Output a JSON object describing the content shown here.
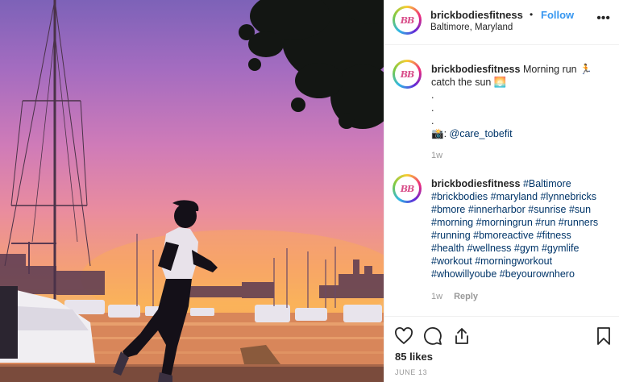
{
  "post": {
    "username": "brickbodiesfitness",
    "separator": "•",
    "follow_label": "Follow",
    "location": "Baltimore, Maryland",
    "more_label": "•••",
    "avatar_text": "BB"
  },
  "caption": {
    "username": "brickbodiesfitness",
    "text_line1": "Morning run 🏃",
    "text_line2": "catch the sun 🌅",
    "dots": ".",
    "credit_icon": "📸",
    "credit_handle": "@care_tobefit",
    "age": "1w"
  },
  "hashtag_comment": {
    "username": "brickbodiesfitness",
    "tags": [
      "#Baltimore",
      "#brickbodies",
      "#maryland",
      "#lynnebricks",
      "#bmore",
      "#innerharbor",
      "#sunrise",
      "#sun",
      "#morning",
      "#morningrun",
      "#run",
      "#runners",
      "#running",
      "#bmoreactive",
      "#fitness",
      "#health",
      "#wellness",
      "#gym",
      "#gymlife",
      "#workout",
      "#morningworkout",
      "#whowillyoube",
      "#beyourownhero"
    ],
    "age": "1w",
    "reply_label": "Reply"
  },
  "actions": {
    "like_icon": "heart-icon",
    "comment_icon": "comment-icon",
    "share_icon": "share-icon",
    "save_icon": "bookmark-icon",
    "likes": "85 likes",
    "date": "June 13"
  },
  "colors": {
    "link": "#3897f0",
    "hashtag": "#003569",
    "muted": "#999999",
    "text": "#262626"
  }
}
